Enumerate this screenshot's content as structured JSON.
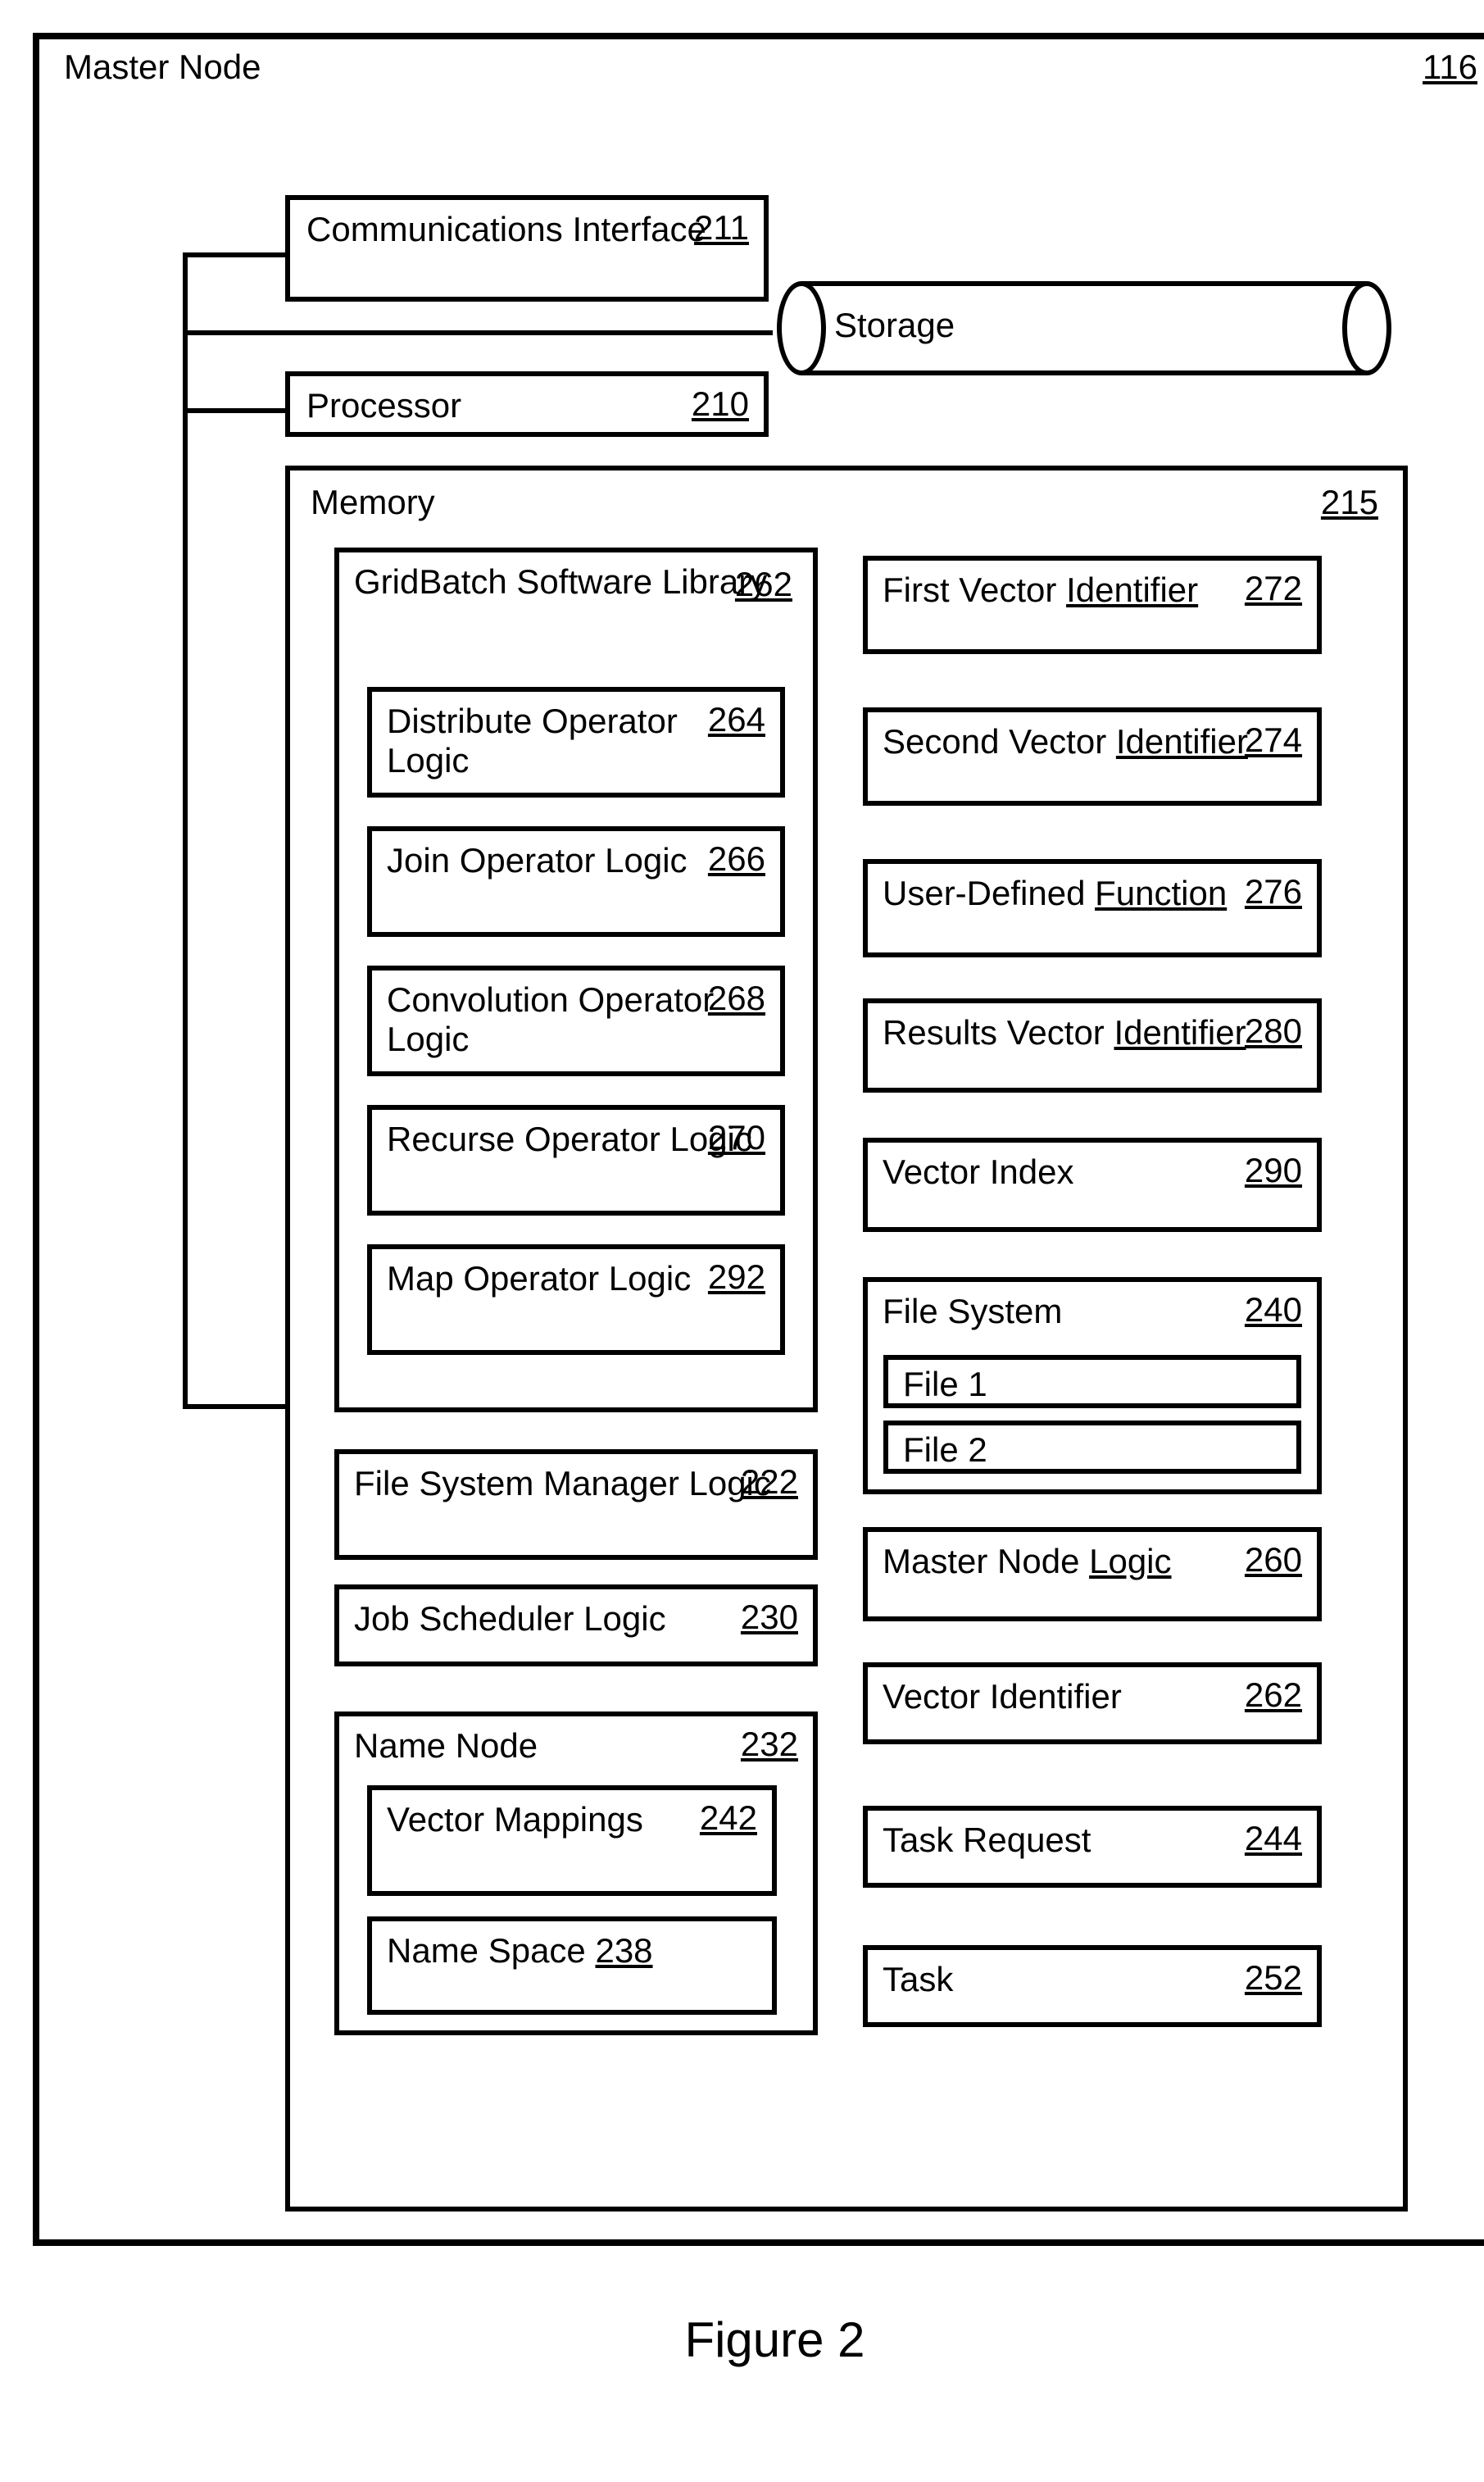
{
  "figure_caption": "Figure 2",
  "master": {
    "label": "Master Node",
    "ref": "116"
  },
  "comm": {
    "label": "Communications Interface",
    "ref": "211"
  },
  "processor": {
    "label": "Processor",
    "ref": "210"
  },
  "storage": {
    "label": "Storage"
  },
  "memory": {
    "label": "Memory",
    "ref": "215"
  },
  "gridbatch": {
    "label": "GridBatch Software Library",
    "ref": "262"
  },
  "dist": {
    "label": "Distribute Operator Logic",
    "ref": "264"
  },
  "join": {
    "label": "Join Operator Logic",
    "ref": "266"
  },
  "conv": {
    "label": "Convolution Operator Logic",
    "ref": "268"
  },
  "recurse": {
    "label": "Recurse Operator Logic",
    "ref": "270"
  },
  "map": {
    "label": "Map Operator Logic",
    "ref": "292"
  },
  "fsm": {
    "label": "File System Manager Logic",
    "ref": "222"
  },
  "jsl": {
    "label": "Job Scheduler Logic",
    "ref": "230"
  },
  "namenode": {
    "label": "Name Node",
    "ref": "232"
  },
  "vecmap": {
    "label": "Vector Mappings",
    "ref": "242"
  },
  "namespace": {
    "label": "Name Space",
    "ref": "238"
  },
  "fvi": {
    "label": "First Vector Identifier",
    "ref": "272"
  },
  "svi": {
    "label": "Second Vector Identifier",
    "ref": "274"
  },
  "udf": {
    "label": "User-Defined Function",
    "ref": "276"
  },
  "rvi": {
    "label": "Results Vector Identifier",
    "ref": "280"
  },
  "vidx": {
    "label": "Vector Index",
    "ref": "290"
  },
  "fs": {
    "label": "File System",
    "ref": "240"
  },
  "file1": {
    "label": "File 1"
  },
  "file2": {
    "label": "File 2"
  },
  "mnl": {
    "label": "Master Node Logic",
    "ref": "260"
  },
  "vid": {
    "label": "Vector Identifier",
    "ref": "262"
  },
  "tr": {
    "label": "Task Request",
    "ref": "244"
  },
  "task": {
    "label": "Task",
    "ref": "252"
  }
}
